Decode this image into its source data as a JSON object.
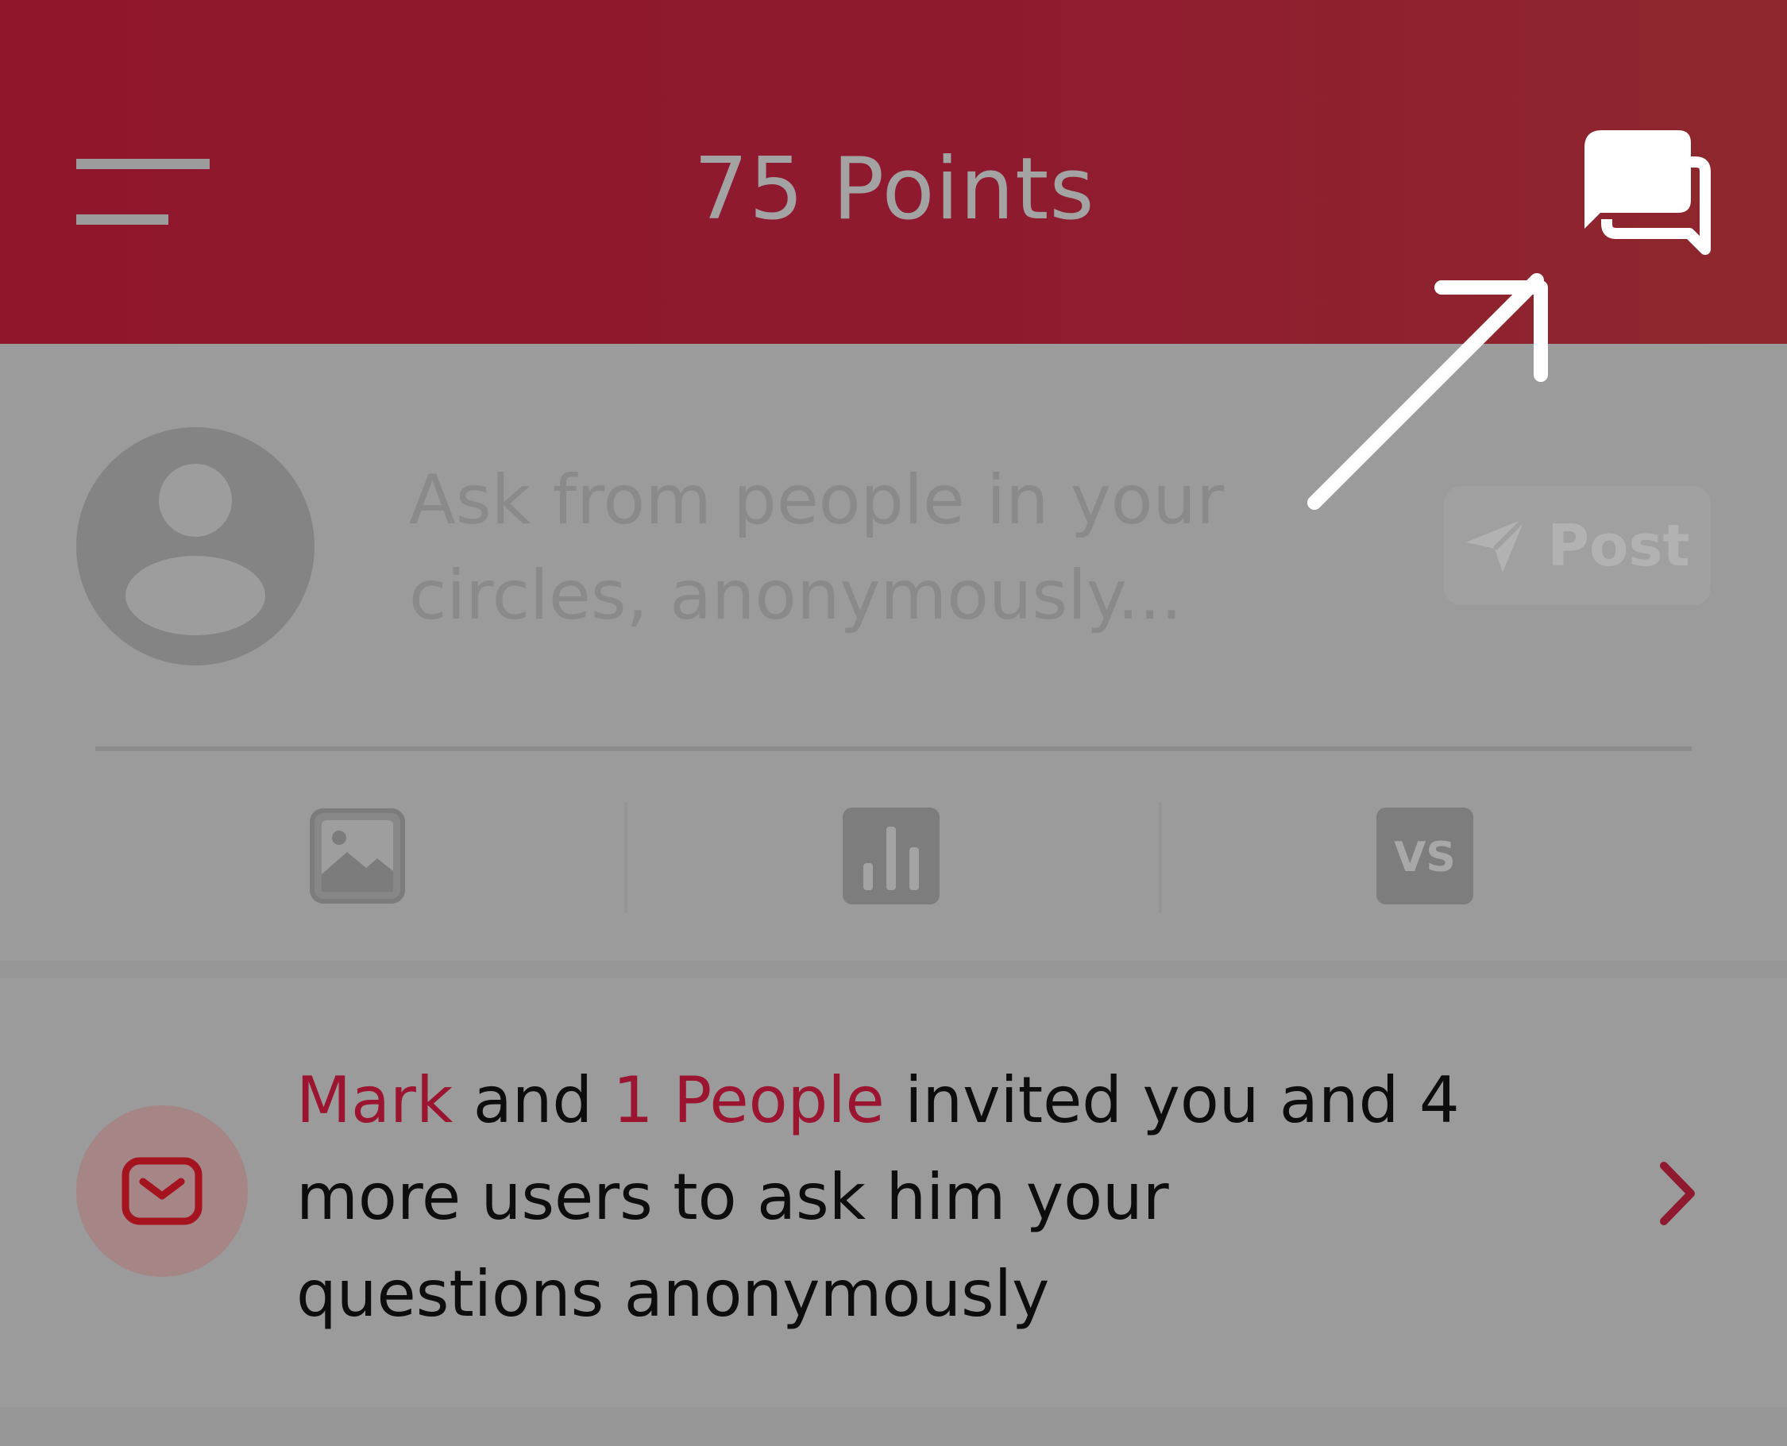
{
  "header": {
    "points_label": "75 Points",
    "menu_icon": "hamburger-menu-icon",
    "chat_icon": "chat-bubbles-icon"
  },
  "composer": {
    "placeholder": "Ask from people in your circles, anonymously...",
    "post_label": "Post",
    "tools": [
      {
        "icon": "image-icon"
      },
      {
        "icon": "poll-icon"
      },
      {
        "icon": "vs-icon",
        "label": "VS"
      }
    ]
  },
  "invite": {
    "name": "Mark",
    "connector": "and",
    "people": "1 People",
    "message": "invited you and 4 more users to ask him your questions anonymously",
    "icon": "mail-icon"
  },
  "colors": {
    "header_bg": "#8f162d",
    "accent": "#9b1530",
    "overlay": "#9b9b9b"
  }
}
